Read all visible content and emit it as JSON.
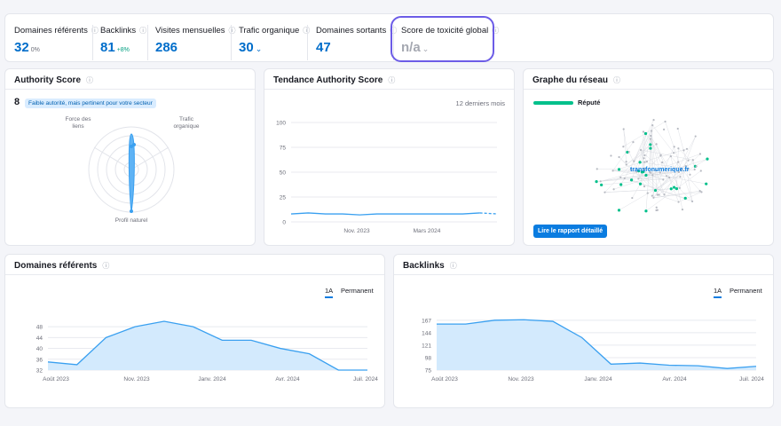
{
  "metrics": {
    "domaines_referents": {
      "label": "Domaines référents",
      "value": "32",
      "sub": "0%"
    },
    "backlinks": {
      "label": "Backlinks",
      "value": "81",
      "sub": "+8%"
    },
    "visites": {
      "label": "Visites mensuelles",
      "value": "286"
    },
    "trafic": {
      "label": "Trafic organique",
      "value": "30"
    },
    "sortants": {
      "label": "Domaines sortants",
      "value": "47"
    },
    "toxicite": {
      "label": "Score de toxicité global",
      "value": "n/a"
    }
  },
  "authority": {
    "title": "Authority Score",
    "score": "8",
    "badge": "Faible autorité, mais pertinent pour votre secteur",
    "axes": [
      "Force des liens",
      "Trafic organique",
      "Profil naturel"
    ],
    "axis_lines": [
      [
        "Force des",
        "liens"
      ],
      [
        "Trafic",
        "organique"
      ]
    ]
  },
  "tendance": {
    "title": "Tendance Authority Score",
    "period": "12 derniers mois",
    "chart_data": {
      "type": "line",
      "ylim": [
        0,
        100
      ],
      "yticks": [
        "100",
        "75",
        "50",
        "25",
        "0"
      ],
      "xticks": [
        "Nov. 2023",
        "Mars 2024"
      ],
      "values": [
        8,
        9,
        8,
        8,
        7,
        8,
        8,
        8,
        8,
        8,
        8,
        9,
        8
      ]
    }
  },
  "graphe": {
    "title": "Graphe du réseau",
    "legend": "Réputé",
    "domain": "transfonumerique.fr",
    "button": "Lire le rapport détaillé"
  },
  "domaines_chart": {
    "title": "Domaines référents",
    "tabs": [
      "1A",
      "Permanent"
    ],
    "chart_data": {
      "type": "area",
      "ylim": [
        32,
        50
      ],
      "yticks": [
        "48",
        "44",
        "40",
        "36",
        "32"
      ],
      "xticks": [
        "Août 2023",
        "Nov. 2023",
        "Janv. 2024",
        "Avr. 2024",
        "Juil. 2024"
      ],
      "values": [
        35,
        34,
        44,
        48,
        50,
        48,
        43,
        43,
        40,
        38,
        32,
        32
      ]
    }
  },
  "backlinks_chart": {
    "title": "Backlinks",
    "tabs": [
      "1A",
      "Permanent"
    ],
    "chart_data": {
      "type": "area",
      "ylim": [
        75,
        170
      ],
      "yticks": [
        "167",
        "144",
        "121",
        "98",
        "75"
      ],
      "xticks": [
        "Août 2023",
        "Nov. 2023",
        "Janv. 2024",
        "Avr. 2024",
        "Juil. 2024"
      ],
      "values": [
        160,
        160,
        167,
        168,
        165,
        135,
        86,
        88,
        84,
        83,
        78,
        82
      ]
    }
  },
  "colors": {
    "accent": "#0a7ce0",
    "line": "#3aa0f0",
    "fill": "#d3eafd",
    "green": "#00c08b",
    "highlight": "#6c5ce7"
  }
}
